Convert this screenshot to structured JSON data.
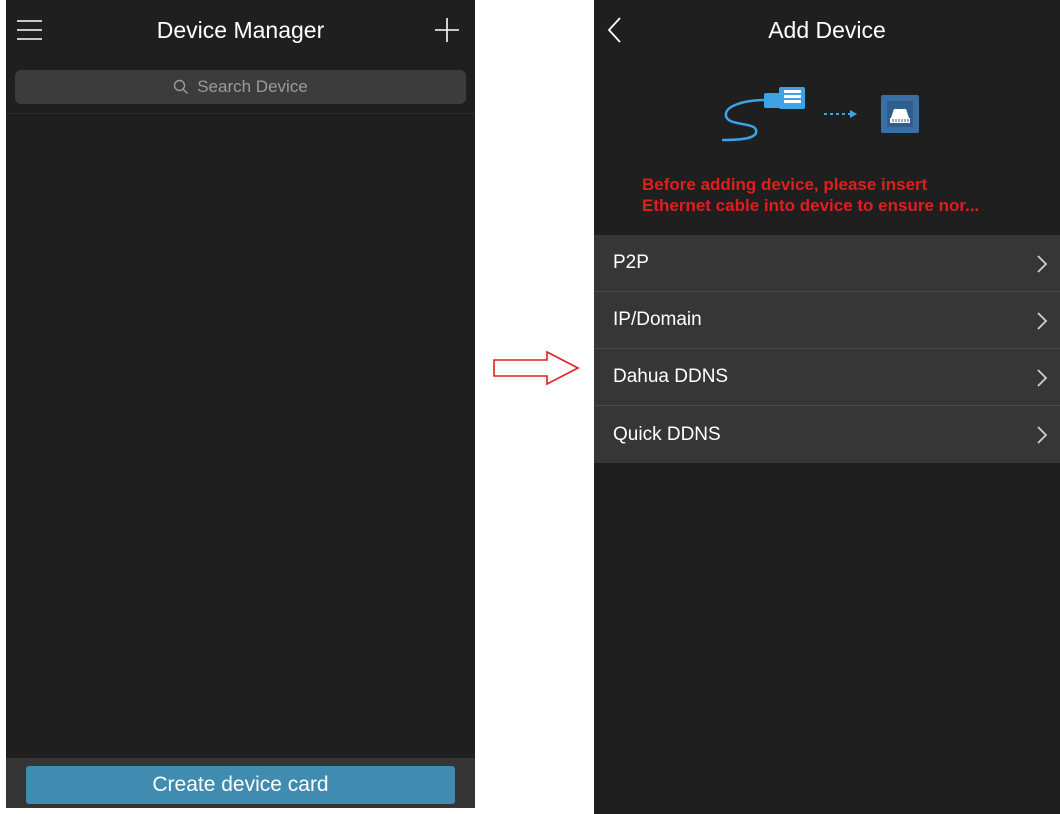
{
  "left_screen": {
    "title": "Device Manager",
    "menu_icon": "hamburger-menu-icon",
    "add_icon": "plus-icon",
    "search": {
      "icon": "search-icon",
      "placeholder": "Search Device"
    },
    "create_button_label": "Create device card"
  },
  "transition_arrow": {
    "icon": "right-arrow-icon",
    "color": "#e0201e"
  },
  "right_screen": {
    "title": "Add Device",
    "back_icon": "chevron-left-icon",
    "illustration": "ethernet-cable-to-port-illustration",
    "warning_lines": [
      "Before adding device, please insert",
      "Ethernet cable into device to ensure nor..."
    ],
    "warning_color": "#e01e1e",
    "menu_items": [
      {
        "label": "P2P",
        "icon": "chevron-right-icon"
      },
      {
        "label": "IP/Domain",
        "icon": "chevron-right-icon"
      },
      {
        "label": "Dahua DDNS",
        "icon": "chevron-right-icon"
      },
      {
        "label": "Quick DDNS",
        "icon": "chevron-right-icon"
      }
    ]
  },
  "colors": {
    "background": "#1f1f1f",
    "menu_background": "#363636",
    "accent_button": "#3f8cb0"
  }
}
